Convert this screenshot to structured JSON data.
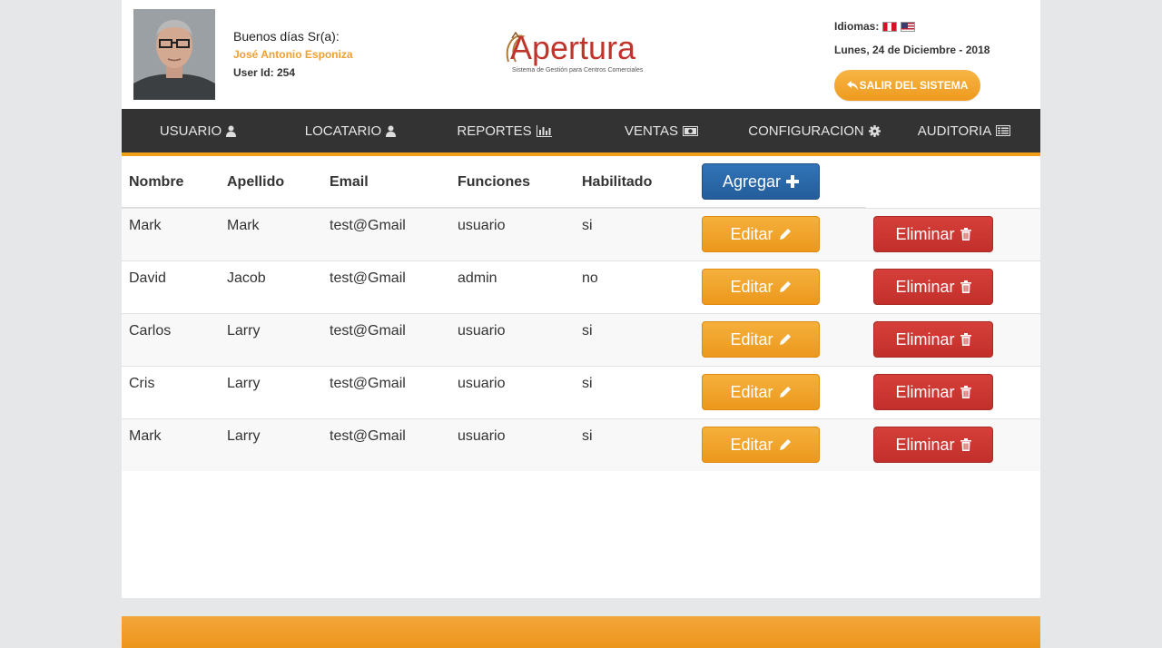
{
  "header": {
    "greeting": "Buenos días Sr(a):",
    "user_name": "José Antonio Esponiza",
    "user_id": "User Id: 254",
    "logo_brand": "Apertura",
    "logo_tagline": "Sistema de Gestión para Centros Comerciales",
    "languages_label": "Idiomas:",
    "date": "Lunes, 24 de Diciembre - 2018",
    "logout_label": "SALIR DEL SISTEMA"
  },
  "nav": {
    "items": [
      {
        "label": "USUARIO",
        "icon": "user-icon"
      },
      {
        "label": "LOCATARIO",
        "icon": "user-icon"
      },
      {
        "label": "REPORTES",
        "icon": "bar-chart-icon"
      },
      {
        "label": "VENTAS",
        "icon": "money-icon"
      },
      {
        "label": "CONFIGURACION",
        "icon": "gear-icon"
      },
      {
        "label": "AUDITORIA",
        "icon": "list-icon"
      }
    ]
  },
  "table": {
    "columns": [
      "Nombre",
      "Apellido",
      "Email",
      "Funciones",
      "Habilitado"
    ],
    "add_label": "Agregar",
    "edit_label": "Editar",
    "delete_label": "Eliminar",
    "rows": [
      [
        "Mark",
        "Mark",
        "test@Gmail",
        "usuario",
        "si"
      ],
      [
        "David",
        "Jacob",
        "test@Gmail",
        "admin",
        "no"
      ],
      [
        "Carlos",
        "Larry",
        "test@Gmail",
        "usuario",
        "si"
      ],
      [
        "Cris",
        "Larry",
        "test@Gmail",
        "usuario",
        "si"
      ],
      [
        "Mark",
        "Larry",
        "test@Gmail",
        "usuario",
        "si"
      ]
    ]
  },
  "colors": {
    "accent_orange": "#f0a018",
    "nav_bg": "#333333",
    "primary_blue": "#2c6aab",
    "danger_red": "#cc3832"
  }
}
